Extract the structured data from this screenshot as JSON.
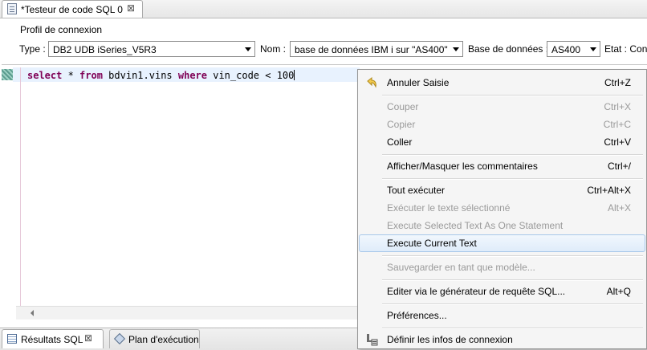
{
  "editor_tab": {
    "title": "*Testeur de code SQL 0",
    "close": "⊠"
  },
  "profile": {
    "group_label": "Profil de connexion",
    "type_label": "Type :",
    "type_value": "DB2 UDB iSeries_V5R3",
    "nom_label": "Nom :",
    "nom_value": "base de données IBM i sur \"AS400\"",
    "db_label": "Base de données :",
    "db_value": "AS400",
    "etat_label": "Etat : Con"
  },
  "editor": {
    "tokens": [
      {
        "text": "select",
        "kw": true
      },
      {
        "text": " * ",
        "kw": false
      },
      {
        "text": "from",
        "kw": true
      },
      {
        "text": " bdvin1.vins ",
        "kw": false
      },
      {
        "text": "where",
        "kw": true
      },
      {
        "text": " vin_code < 100",
        "kw": false
      }
    ]
  },
  "bottom_tabs": [
    {
      "label": "Résultats SQL",
      "close": "⊠"
    },
    {
      "label": "Plan d'exécution"
    }
  ],
  "context_menu": {
    "items": [
      {
        "label": "Annuler Saisie",
        "shortcut": "Ctrl+Z",
        "enabled": true,
        "icon": "undo-icon"
      },
      {
        "label": "Couper",
        "shortcut": "Ctrl+X",
        "enabled": false
      },
      {
        "label": "Copier",
        "shortcut": "Ctrl+C",
        "enabled": false
      },
      {
        "label": "Coller",
        "shortcut": "Ctrl+V",
        "enabled": true
      },
      {
        "label": "Afficher/Masquer les commentaires",
        "shortcut": "Ctrl+/",
        "enabled": true
      },
      {
        "label": "Tout exécuter",
        "shortcut": "Ctrl+Alt+X",
        "enabled": true
      },
      {
        "label": "Exécuter le texte sélectionné",
        "shortcut": "Alt+X",
        "enabled": false
      },
      {
        "label": "Execute Selected Text As One Statement",
        "shortcut": "",
        "enabled": false
      },
      {
        "label": "Execute Current Text",
        "shortcut": "",
        "enabled": true,
        "highlighted": true
      },
      {
        "label": "Sauvegarder en tant que modèle...",
        "shortcut": "",
        "enabled": false
      },
      {
        "label": "Editer via le générateur de requête SQL...",
        "shortcut": "Alt+Q",
        "enabled": true
      },
      {
        "label": "Préférences...",
        "shortcut": "",
        "enabled": true
      },
      {
        "label": "Définir les infos de connexion",
        "shortcut": "",
        "enabled": true,
        "icon": "connection-icon"
      }
    ]
  },
  "colors": {
    "keyword": "#7f0055",
    "highlight": "#dfecfa",
    "disabled": "#9a9a9a"
  }
}
